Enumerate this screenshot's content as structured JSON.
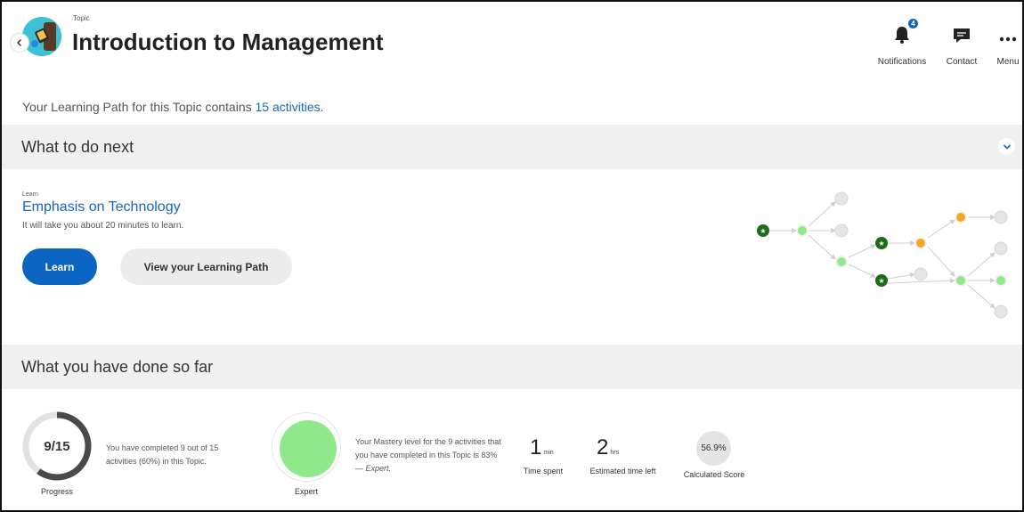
{
  "header": {
    "topic_label": "Topic",
    "title": "Introduction to Management",
    "actions": [
      {
        "label": "Notifications",
        "icon": "bell-icon",
        "badge": "4"
      },
      {
        "label": "Contact",
        "icon": "chat-icon"
      },
      {
        "label": "Menu",
        "icon": "more-dots-icon"
      }
    ]
  },
  "summary": {
    "prefix": "Your Learning Path for this Topic contains",
    "link": "15 activities",
    "suffix": "."
  },
  "next": {
    "section_title": "What to do next",
    "type": "Learn",
    "title": "Emphasis on Technology",
    "subtitle": "It will take you about 20 minutes to learn.",
    "learn_button": "Learn",
    "path_button": "View your Learning Path"
  },
  "done": {
    "section_title": "What you have done so far",
    "progress": {
      "value": "9/15",
      "fraction": 0.6,
      "label": "Progress",
      "text": "You have completed 9 out of 15 activities (60%) in this Topic."
    },
    "mastery": {
      "label": "Expert",
      "text_prefix": "Your Mastery level for the 9 activities that you have completed in this Topic is 83% — ",
      "text_level": "Expert."
    },
    "time_spent": {
      "value": "1",
      "unit": "min",
      "label": "Time spent"
    },
    "time_left": {
      "value": "2",
      "unit": "hrs",
      "label": "Estimated time left"
    },
    "score": {
      "value": "56.9%",
      "label": "Calculated Score"
    }
  },
  "colors": {
    "accent": "#0b66c3",
    "link": "#1565c0",
    "completed_node": "#1b6b1b",
    "mastered_node": "#8fe88a",
    "in_progress_node": "#f5a623",
    "locked_node": "#e6e6e6"
  }
}
